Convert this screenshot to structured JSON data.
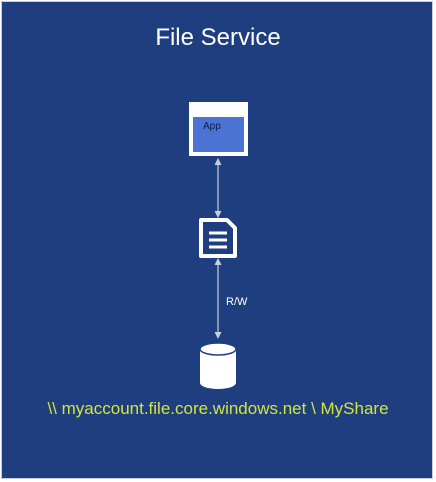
{
  "title": "File Service",
  "app": {
    "label": "App",
    "icon": "app-window-icon"
  },
  "document_icon": "document-icon",
  "connection_label": "R/W",
  "storage_icon": "storage-cylinder-icon",
  "share_path": "\\\\ myaccount.file.core.windows.net \\ MyShare",
  "colors": {
    "background": "#1e3e80",
    "app_fill": "#4a73d3",
    "connector": "#c9cede",
    "path_text": "#d4e53a"
  }
}
